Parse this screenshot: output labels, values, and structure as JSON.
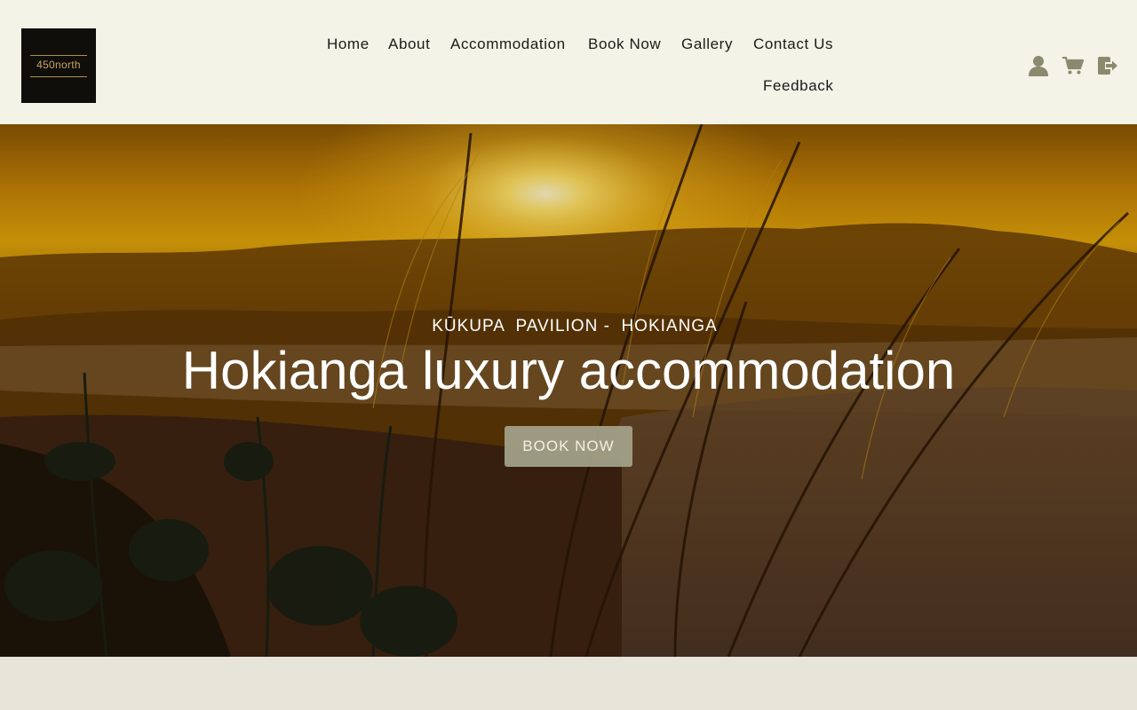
{
  "site": {
    "logo_text": "450north"
  },
  "nav": {
    "items": [
      {
        "label": "Home"
      },
      {
        "label": "About"
      },
      {
        "label": "Accommodation"
      },
      {
        "label": "Book Now"
      },
      {
        "label": "Gallery"
      },
      {
        "label": "Contact Us"
      },
      {
        "label": "Feedback"
      }
    ]
  },
  "header_icons": [
    {
      "icon": "user-icon"
    },
    {
      "icon": "cart-icon"
    },
    {
      "icon": "logout-icon"
    }
  ],
  "hero": {
    "eyebrow": "KŪKUPA  PAVILION -  HOKIANGA",
    "headline": "Hokianga luxury accommodation",
    "cta_label": "BOOK NOW"
  },
  "colors": {
    "header_bg": "#f4f3e8",
    "icon_color": "#8a8a6e",
    "cta_bg": "#a5a48c",
    "page_bg": "#e7e4d9"
  }
}
